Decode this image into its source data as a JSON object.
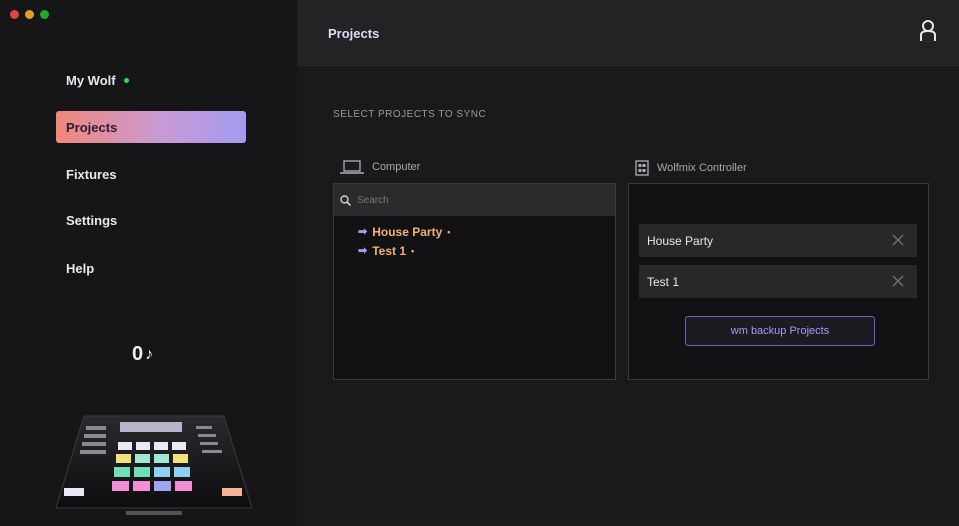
{
  "window": {
    "controls": [
      "close",
      "minimize",
      "zoom"
    ]
  },
  "sidebar": {
    "items": [
      {
        "label": "My Wolf",
        "status": "connected"
      },
      {
        "label": "Projects",
        "active": true
      },
      {
        "label": "Fixtures"
      },
      {
        "label": "Settings"
      },
      {
        "label": "Help"
      }
    ],
    "counter": "0"
  },
  "header": {
    "title": "Projects"
  },
  "main": {
    "section_title": "SELECT PROJECTS TO SYNC",
    "computer": {
      "title": "Computer",
      "search_placeholder": "Search",
      "projects": [
        {
          "label": "House Party",
          "marker": "•"
        },
        {
          "label": "Test 1",
          "marker": "•"
        }
      ]
    },
    "device": {
      "title": "Wolfmix Controller",
      "projects": [
        {
          "label": "House Party"
        },
        {
          "label": "Test 1"
        }
      ],
      "backup_button": "wm backup Projects"
    }
  },
  "colors": {
    "accent": "#a49cf2",
    "active_gradient_start": "#f2877a",
    "active_gradient_end": "#a39bf0",
    "project_label": "#f1b07a"
  }
}
